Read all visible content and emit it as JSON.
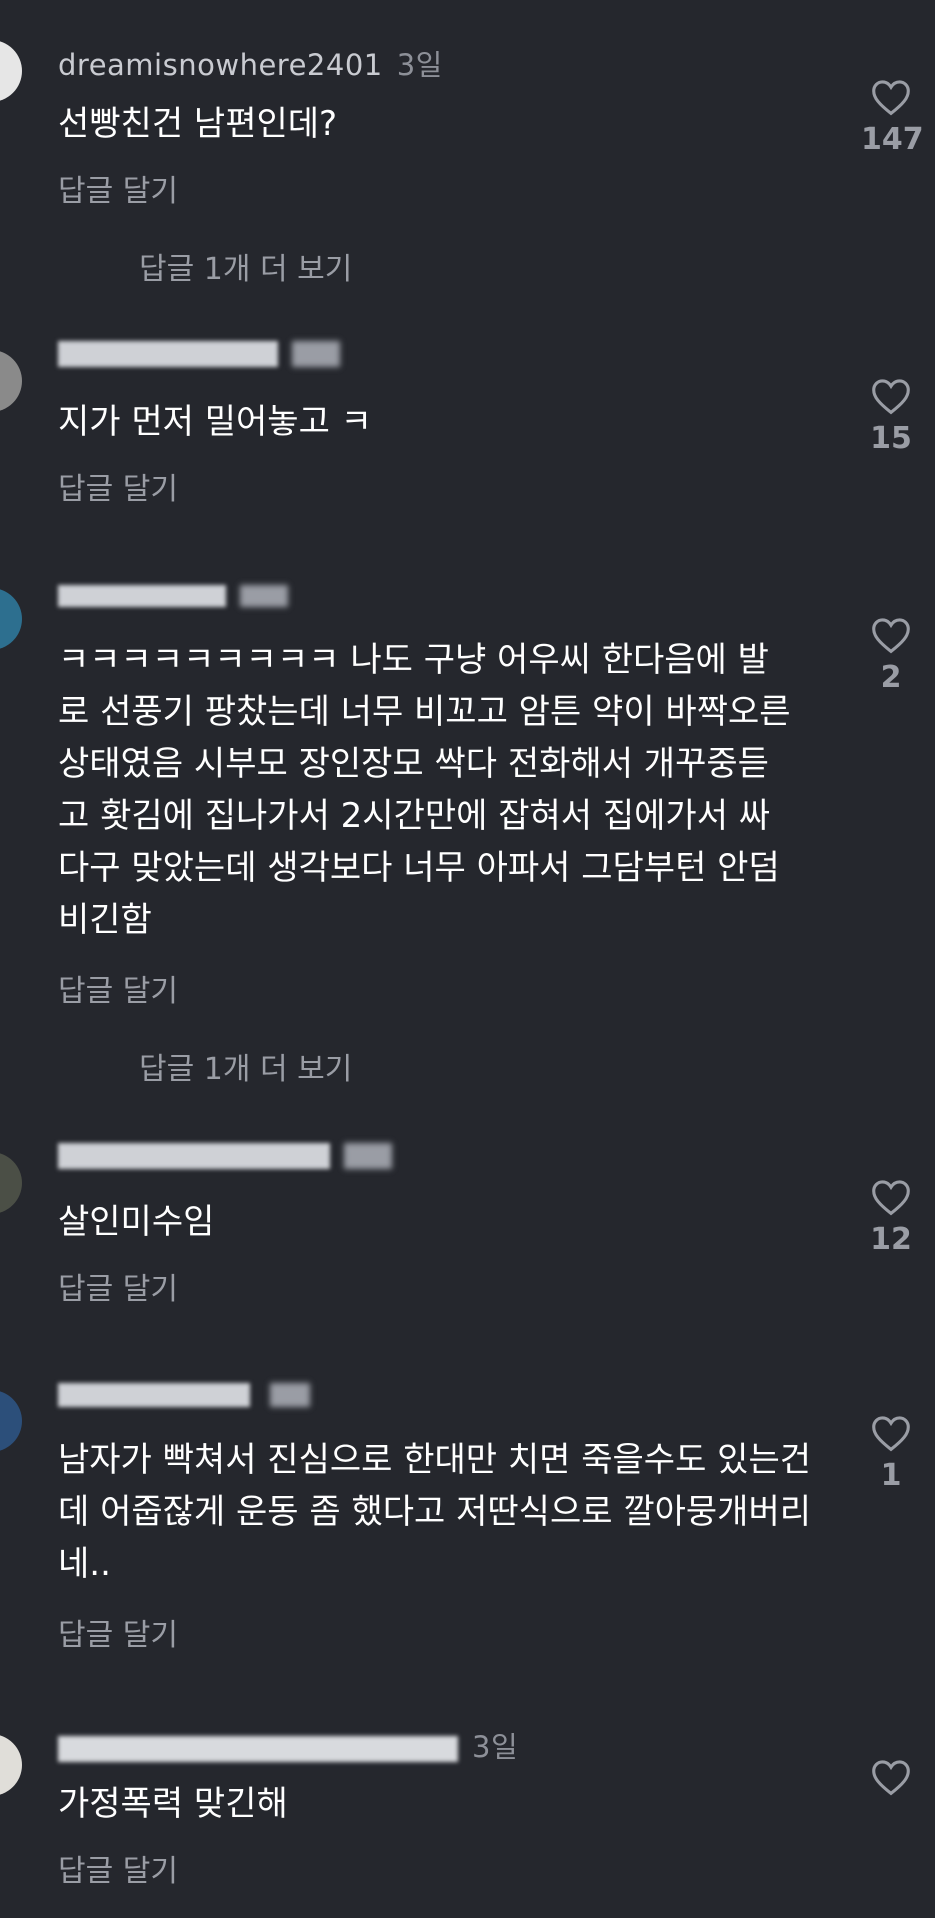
{
  "comments": [
    {
      "username": "dreamisnowhere2401",
      "time": "3일",
      "text": "선빵친건 남편인데?",
      "reply": "답글 달기",
      "likes": "147",
      "more": "답글 1개 더 보기",
      "avatar_color": "#e6e6e6"
    },
    {
      "username": "",
      "time": "",
      "text": "지가 먼저 밀어놓고 ㅋ",
      "reply": "답글 달기",
      "likes": "15",
      "avatar_color": "#8a8a8a"
    },
    {
      "username": "",
      "time": "",
      "text": "ㅋㅋㅋㅋㅋㅋㅋㅋㅋ 나도 구냥 어우씨 한다음에 발로 선풍기 팡찼는데 너무 비꼬고 암튼 약이 바짝오른상태였음 시부모 장인장모 싹다 전화해서 개꾸중듣고 홧김에 집나가서 2시간만에 잡혀서 집에가서 싸다구 맞았는데 생각보다 너무 아파서 그담부턴 안덤비긴함",
      "reply": "답글 달기",
      "likes": "2",
      "more": "답글 1개 더 보기",
      "avatar_color": "#2d6f8f"
    },
    {
      "username": "",
      "time": "",
      "text": "살인미수임",
      "reply": "답글 달기",
      "likes": "12",
      "avatar_color": "#4b4f46"
    },
    {
      "username": "",
      "time": "",
      "text": "남자가 빡쳐서 진심으로 한대만 치면 죽을수도 있는건데 어줍잖게 운동 좀 했다고 저딴식으로 깔아뭉개버리네..",
      "reply": "답글 달기",
      "likes": "1",
      "avatar_color": "#2c4f7a"
    },
    {
      "username": "",
      "time": "3일",
      "text": "가정폭력 맞긴해",
      "reply": "답글 달기",
      "likes": "",
      "avatar_color": "#e0ded9"
    }
  ]
}
